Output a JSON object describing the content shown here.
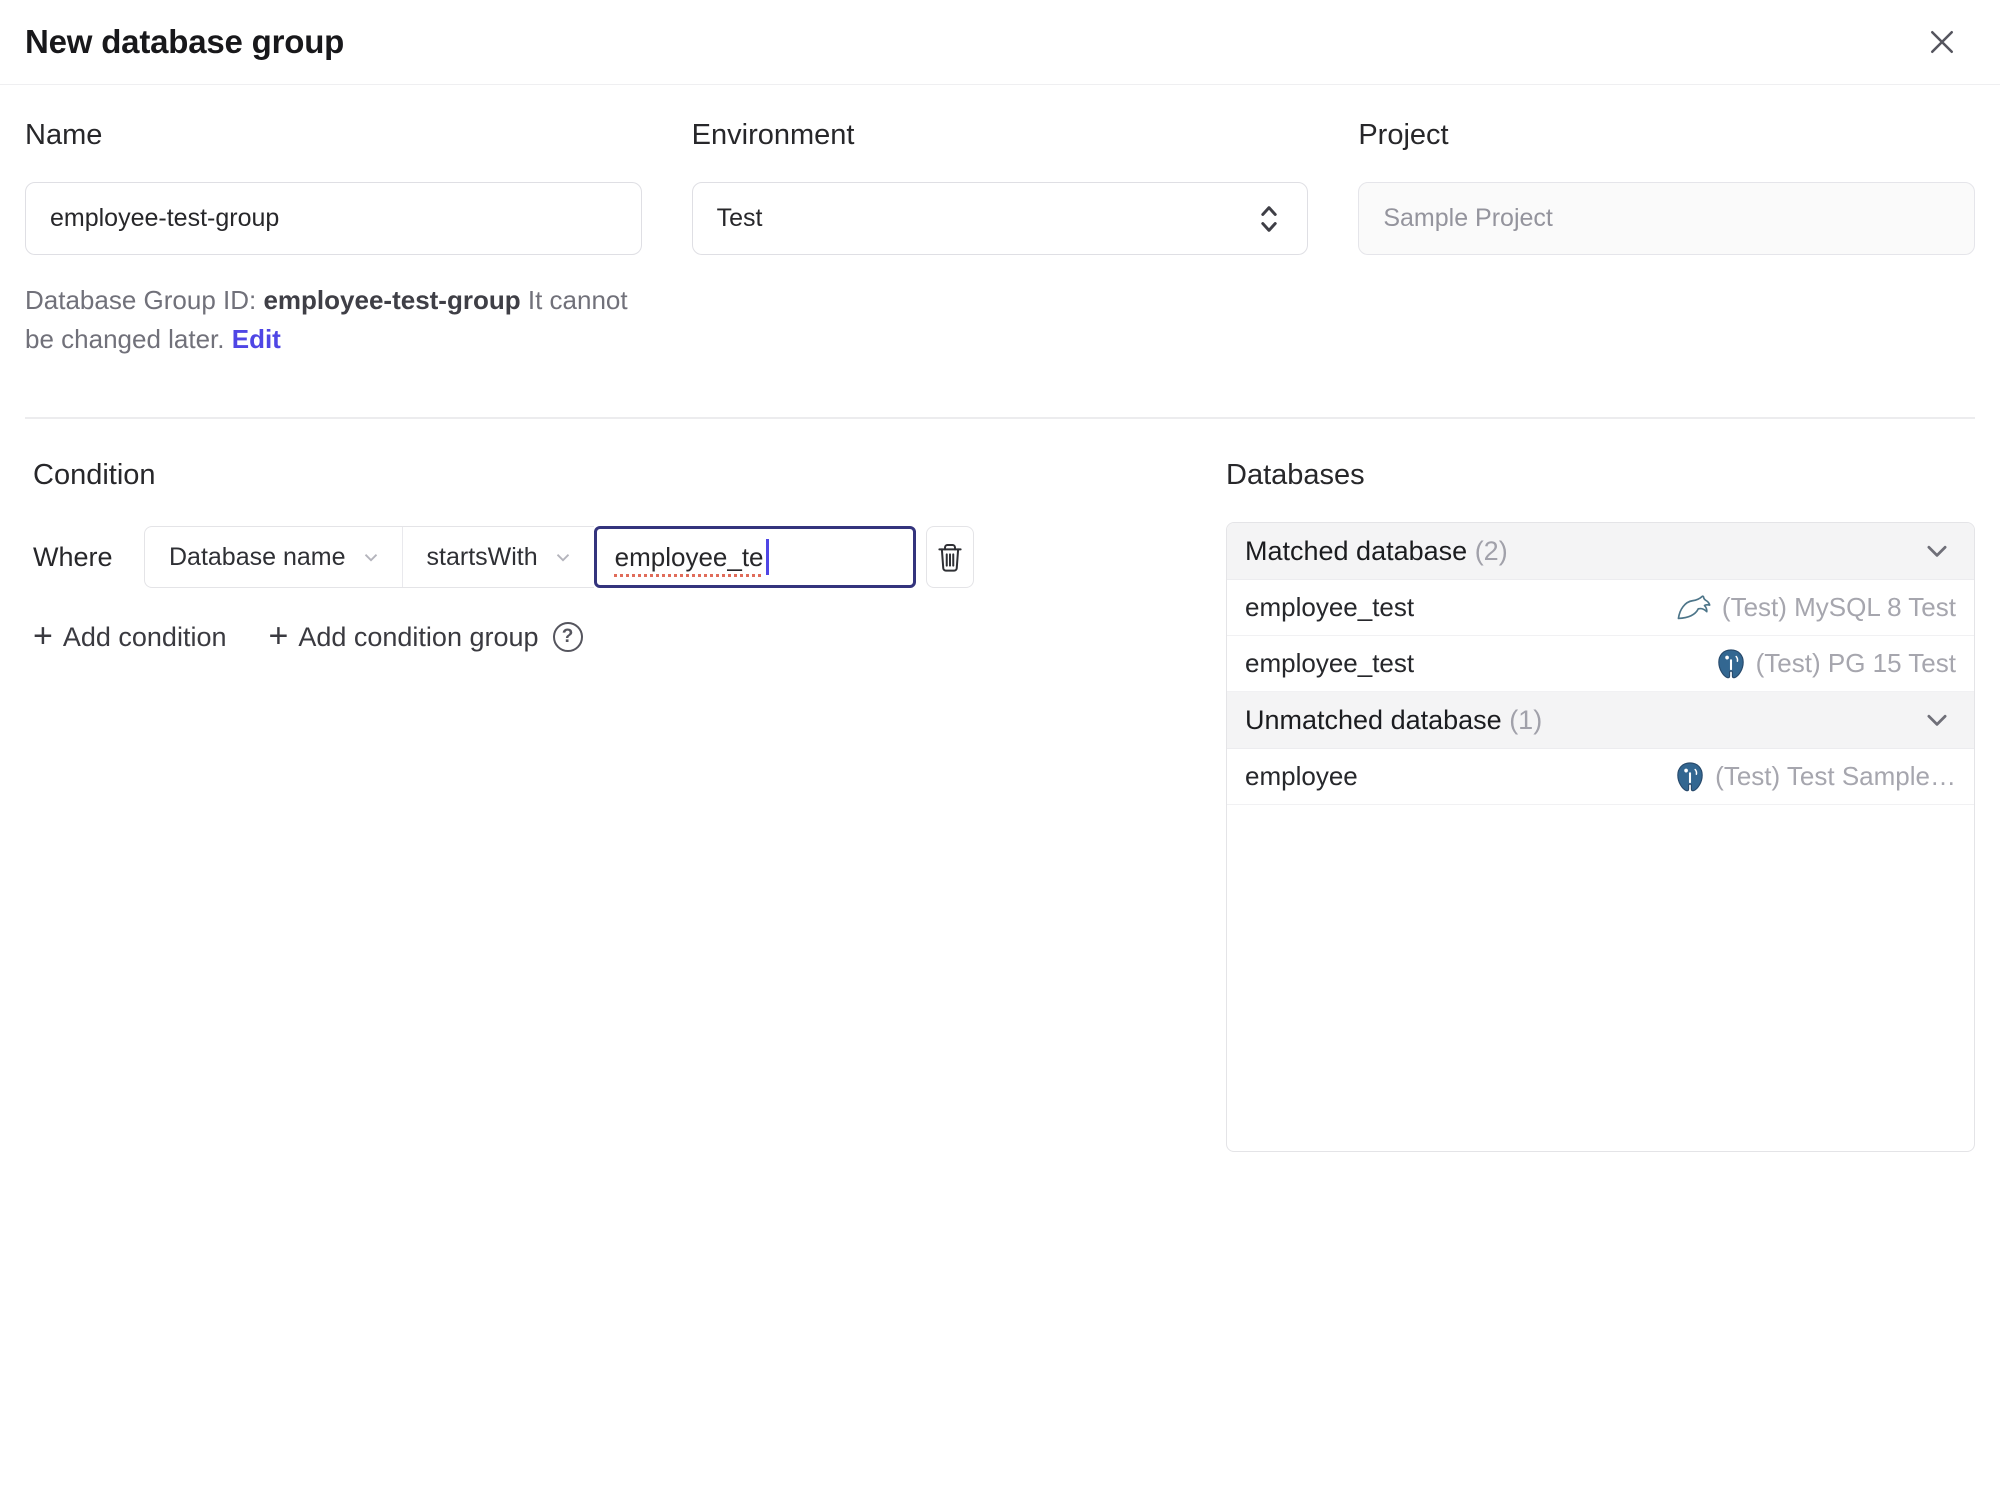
{
  "header": {
    "title": "New database group"
  },
  "form": {
    "name_label": "Name",
    "name_value": "employee-test-group",
    "environment_label": "Environment",
    "environment_value": "Test",
    "project_label": "Project",
    "project_value": "Sample Project",
    "group_id": {
      "prefix": "Database Group ID:",
      "value": "employee-test-group",
      "note": "It cannot be changed later.",
      "edit": "Edit"
    }
  },
  "condition": {
    "heading": "Condition",
    "where": "Where",
    "factor": "Database name",
    "operator": "startsWith",
    "value": "employee_te",
    "add_condition": "Add condition",
    "add_condition_group": "Add condition group",
    "help_glyph": "?"
  },
  "databases": {
    "heading": "Databases",
    "matched": {
      "label": "Matched database",
      "count": "(2)"
    },
    "unmatched": {
      "label": "Unmatched database",
      "count": "(1)"
    },
    "rows": [
      {
        "name": "employee_test",
        "engine": "mysql-icon",
        "instance": "(Test) MySQL 8 Test"
      },
      {
        "name": "employee_test",
        "engine": "postgresql-icon",
        "instance": "(Test) PG 15 Test"
      },
      {
        "name": "employee",
        "engine": "postgresql-icon",
        "instance": "(Test) Test Sample…"
      }
    ]
  },
  "colors": {
    "accent": "#4f46e5",
    "focus_border": "#34347d",
    "spellcheck_underline": "#e06c5a",
    "header_bg": "#f4f4f5",
    "mysql_icon": "#4d7589",
    "postgres_icon": "#336791",
    "muted_text": "#a6a6ae"
  }
}
